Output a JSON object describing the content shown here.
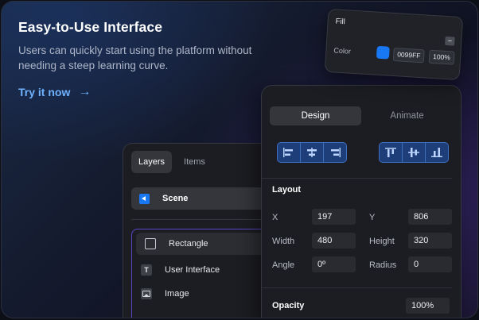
{
  "hero": {
    "title": "Easy-to-Use Interface",
    "description": "Users can quickly start using the platform without needing a steep learning curve.",
    "cta_label": "Try it now",
    "cta_arrow": "→"
  },
  "fill_popover": {
    "title": "Fill",
    "minus_icon": "−",
    "color_label": "Color",
    "color_hex": "0099FF",
    "opacity": "100%",
    "swatch_color": "#1877f2"
  },
  "layers_panel": {
    "tabs": [
      {
        "label": "Layers"
      },
      {
        "label": "Items"
      }
    ],
    "scene_label": "Scene",
    "items": [
      {
        "label": "Rectangle",
        "icon": "rectangle-icon"
      },
      {
        "label": "User Interface",
        "icon": "text-icon",
        "glyph": "T"
      },
      {
        "label": "Image",
        "icon": "image-icon"
      }
    ]
  },
  "design_panel": {
    "tabs": [
      {
        "label": "Design"
      },
      {
        "label": "Animate"
      }
    ],
    "layout_title": "Layout",
    "props": {
      "x_label": "X",
      "x_value": "197",
      "y_label": "Y",
      "y_value": "806",
      "width_label": "Width",
      "width_value": "480",
      "height_label": "Height",
      "height_value": "320",
      "angle_label": "Angle",
      "angle_value": "0º",
      "radius_label": "Radius",
      "radius_value": "0"
    },
    "opacity_title": "Opacity",
    "opacity_value": "100%"
  },
  "colors": {
    "accent_blue": "#1877f2",
    "link_blue": "#6fb2ff",
    "selection_purple": "#5b46c9"
  }
}
